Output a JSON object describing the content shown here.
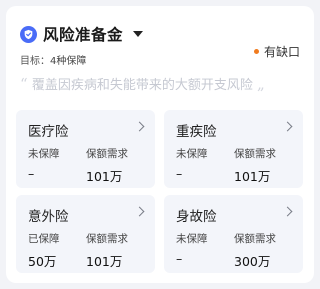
{
  "header": {
    "title": "风险准备金",
    "target_label": "目标：",
    "target_value": "4种保障",
    "gap_status": "有缺口",
    "quote_open": "“",
    "quote_text": "覆盖因疾病和失能带来的大额开支风险",
    "quote_close": "„"
  },
  "colors": {
    "accent": "#4a6cf7",
    "status_dot": "#f07b1e",
    "tile_bg": "#f3f5fa",
    "page_bg": "#f2f3f7"
  },
  "tiles": [
    {
      "name": "医疗险",
      "status_label": "未保障",
      "status_value": "–",
      "need_label": "保额需求",
      "need_value": "101万"
    },
    {
      "name": "重疾险",
      "status_label": "未保障",
      "status_value": "–",
      "need_label": "保额需求",
      "need_value": "101万"
    },
    {
      "name": "意外险",
      "status_label": "已保障",
      "status_value": "50万",
      "need_label": "保额需求",
      "need_value": "101万"
    },
    {
      "name": "身故险",
      "status_label": "未保障",
      "status_value": "–",
      "need_label": "保额需求",
      "need_value": "300万"
    }
  ],
  "icons": {
    "header_icon": "shield-check-icon",
    "dropdown_icon": "caret-down-icon",
    "tile_icon": "chevron-right-icon"
  }
}
